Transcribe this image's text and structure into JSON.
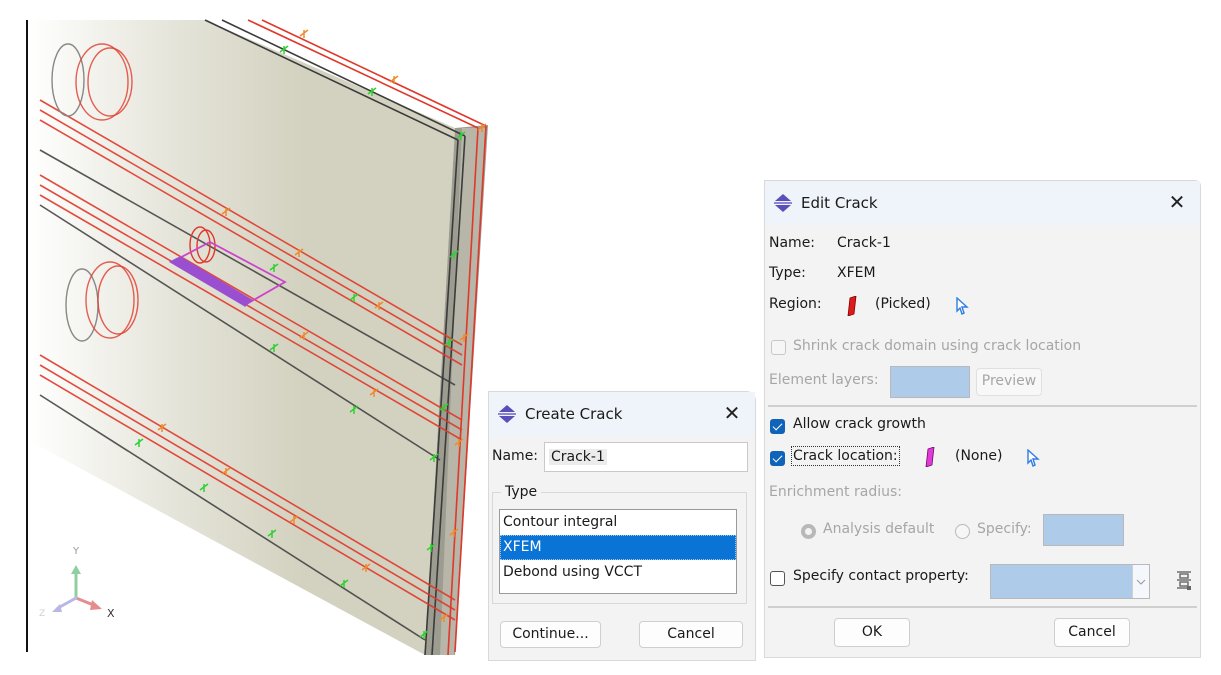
{
  "viewport": {
    "triad": {
      "y_label": "Y",
      "x_label": "X",
      "z_label": "Z"
    },
    "colors": {
      "plate": "#d3d2c0",
      "edge_red": "#e0382a",
      "edge_dark": "#3b3b3b",
      "seed_green": "#2fd12f",
      "seed_orange": "#f08a2a",
      "crack": "#cc44cc"
    }
  },
  "create_crack": {
    "title": "Create Crack",
    "name_label": "Name:",
    "name_value": "Crack-1",
    "type_group_label": "Type",
    "type_options": [
      "Contour integral",
      "XFEM",
      "Debond using VCCT"
    ],
    "selected_type": "XFEM",
    "continue_label": "Continue...",
    "cancel_label": "Cancel"
  },
  "edit_crack": {
    "title": "Edit Crack",
    "name_label": "Name:",
    "name_value": "Crack-1",
    "type_label": "Type:",
    "type_value": "XFEM",
    "region_label": "Region:",
    "region_value": "(Picked)",
    "shrink_label": "Shrink crack domain using crack location",
    "shrink_checked": false,
    "element_layers_label": "Element layers:",
    "preview_label": "Preview",
    "allow_growth_label": "Allow crack growth",
    "allow_growth_checked": true,
    "crack_location_label": "Crack location:",
    "crack_location_checked": true,
    "crack_location_value": "(None)",
    "enrichment_label": "Enrichment radius:",
    "analysis_default_label": "Analysis default",
    "specify_label": "Specify:",
    "enrichment_selected": "Analysis default",
    "contact_label": "Specify contact property:",
    "contact_checked": false,
    "contact_value": "",
    "ok_label": "OK",
    "cancel_label": "Cancel"
  }
}
